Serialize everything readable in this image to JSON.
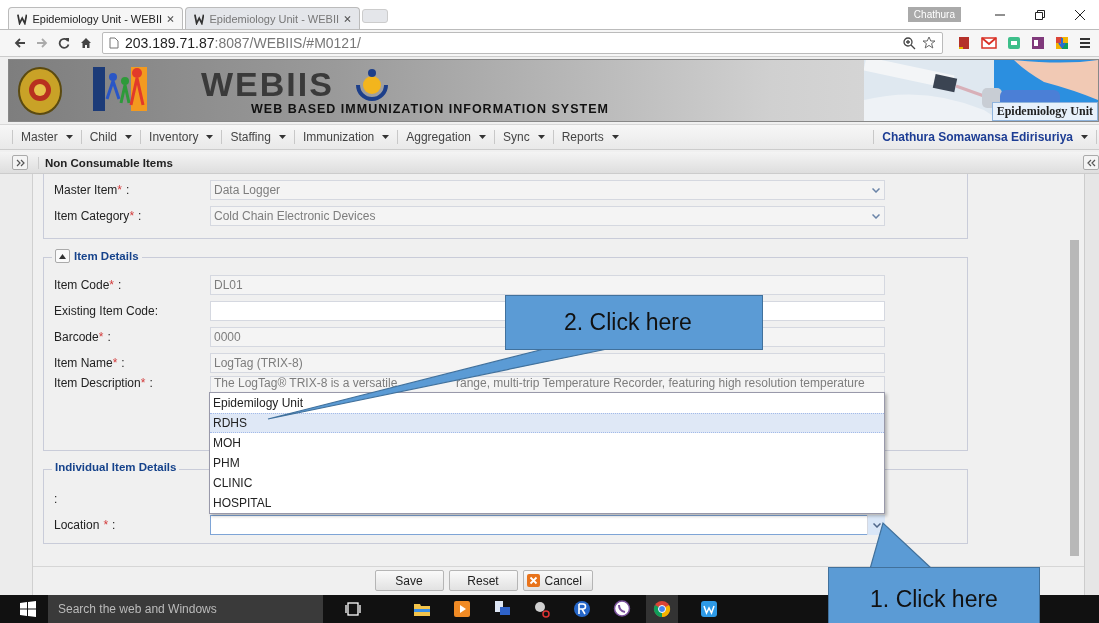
{
  "browser": {
    "tabs": [
      {
        "title": "Epidemiology Unit - WEBII",
        "selected": true
      },
      {
        "title": "Epidemiology Unit - WEBII",
        "selected": false
      }
    ],
    "profile": "Chathura",
    "url_host": "203.189.71.87",
    "url_path": ":8087/WEBIIS/#M0121/"
  },
  "banner": {
    "title": "WEBIIS",
    "subtitle": "WEB BASED IMMUNIZATION INFORMATION SYSTEM",
    "unit": "Epidemiology Unit"
  },
  "menu": {
    "items": [
      "Master",
      "Child",
      "Inventory",
      "Staffing",
      "Immunization",
      "Aggregation",
      "Sync",
      "Reports"
    ],
    "user": "Chathura Somawansa Edirisuriya"
  },
  "panel": {
    "title": "Non Consumable Items"
  },
  "general_fields": [
    {
      "label": "Master Item",
      "mark": "*",
      "colon": ":",
      "kind": "combo",
      "disabled": true,
      "value": "Data Logger"
    },
    {
      "label": "Item Category",
      "mark": "*",
      "colon": ":",
      "kind": "combo",
      "disabled": true,
      "value": "Cold Chain Electronic Devices"
    }
  ],
  "item_details": {
    "title": "Item Details",
    "expanded": true,
    "fields": [
      {
        "label": "Item Code",
        "mark": "*",
        "colon": ":",
        "kind": "text",
        "disabled": true,
        "value": "DL01"
      },
      {
        "label": "Existing Item Code:",
        "kind": "text",
        "disabled": false
      },
      {
        "label": "Barcode",
        "mark": "*",
        "colon": ":",
        "kind": "text",
        "disabled": true,
        "value": "0000"
      },
      {
        "label": "Item Name",
        "mark": "*",
        "colon": ":",
        "kind": "text",
        "disabled": true,
        "value": "LogTag (TRIX-8)"
      },
      {
        "label": "Item Description",
        "mark": "*",
        "colon": ":",
        "kind": "textarea",
        "disabled": true,
        "value_parts": [
          "The LogTag® TRIX-8 is a versatile",
          "range, multi-trip Temperature Recorder, featuring high resolution temperature"
        ]
      }
    ]
  },
  "individual_details": {
    "title": "Individual Item Details",
    "colon_only": ":",
    "location": {
      "label": "Location",
      "mark": "*",
      "colon": ":",
      "open": true,
      "options": [
        {
          "label": "Epidemilogy Unit",
          "selected": false
        },
        {
          "label": "RDHS",
          "selected": true
        },
        {
          "label": "MOH",
          "selected": false
        },
        {
          "label": "PHM",
          "selected": false
        },
        {
          "label": "CLINIC",
          "selected": false
        },
        {
          "label": "HOSPITAL",
          "selected": false
        }
      ]
    }
  },
  "buttons": [
    {
      "label": "Save",
      "kind": "plain"
    },
    {
      "label": "Reset",
      "kind": "plain"
    },
    {
      "label": "Cancel",
      "kind": "cancel"
    }
  ],
  "callouts": [
    {
      "text": "2. Click here",
      "kind": "top"
    },
    {
      "text": "1. Click here",
      "kind": "bottom"
    }
  ],
  "taskbar": {
    "search_placeholder": "Search the web and Windows"
  }
}
